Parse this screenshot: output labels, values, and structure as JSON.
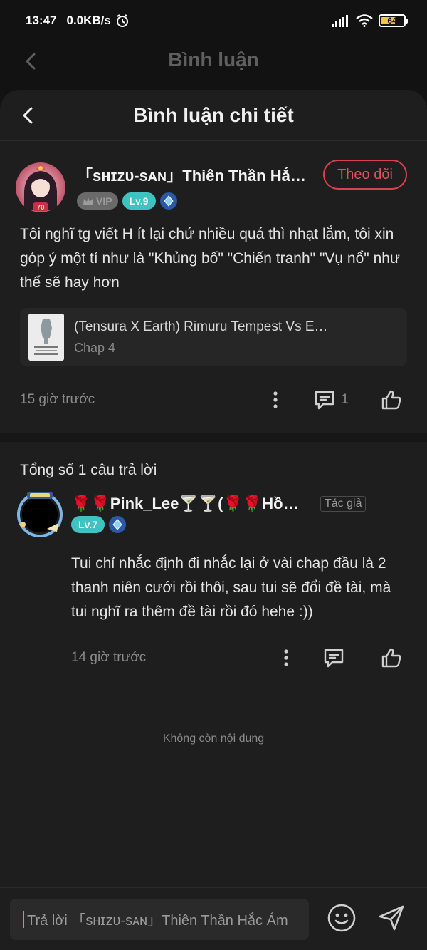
{
  "status_bar": {
    "time": "13:47",
    "speed": "0.0KB/s",
    "battery": "64"
  },
  "background_header": {
    "title": "Bình luận"
  },
  "sheet": {
    "title": "Bình luận chi tiết"
  },
  "comment": {
    "username": "「sʜɪzᴜ-sᴀɴ」Thiên Thần Hắc Ám",
    "vip_label": "VIP",
    "level": "Lv.9",
    "follow_label": "Theo dõi",
    "avatar_badge": "70",
    "text": "Tôi nghĩ tg viết H ít lại chứ nhiều quá thì nhạt lắm, tôi xin góp ý một tí như là \"Khủng bố\" \"Chiến tranh\" \"Vụ nổ\" như thế sẽ hay hơn",
    "story": {
      "title": "(Tensura X Earth) Rimuru Tempest Vs Earth",
      "chapter": "Chap 4"
    },
    "time_ago": "15 giờ trước",
    "reply_count": "1"
  },
  "replies_header": "Tổng số 1 câu trả lời",
  "reply": {
    "username": "🌹🌹Pink_Lee🍸🍸(🌹🌹Hồng Lê)",
    "author_tag": "Tác giả",
    "level": "Lv.7",
    "text": "Tui chỉ nhắc định đi nhắc lại ở vài chap đầu là 2 thanh niên cưới rồi thôi, sau tui sẽ đổi đề tài, mà tui nghĩ ra thêm đề tài rồi đó hehe :))",
    "time_ago": "14 giờ trước"
  },
  "end_note": "Không còn nội dung",
  "input": {
    "placeholder": "Trả lời 「sʜɪzᴜ-sᴀɴ」Thiên Thần Hắc Ám"
  },
  "colors": {
    "accent": "#3fc3c2",
    "follow": "#d9414f",
    "background": "#1e1e1e"
  }
}
